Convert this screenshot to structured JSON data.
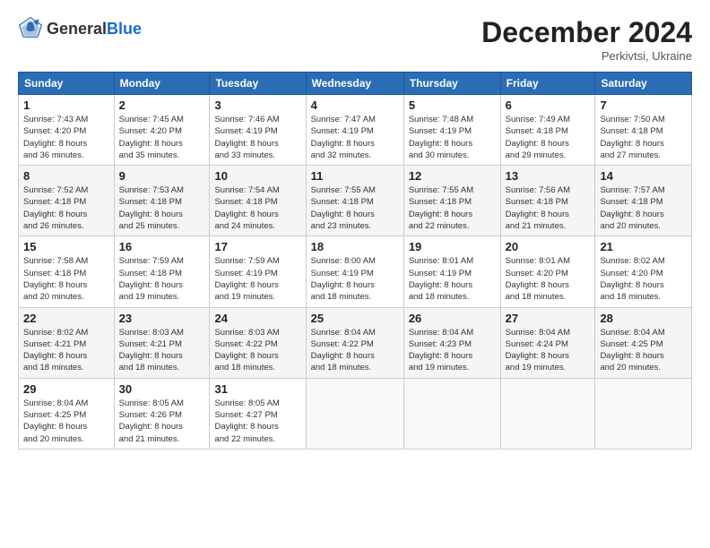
{
  "header": {
    "logo_general": "General",
    "logo_blue": "Blue",
    "title": "December 2024",
    "subtitle": "Perkivtsi, Ukraine"
  },
  "days_of_week": [
    "Sunday",
    "Monday",
    "Tuesday",
    "Wednesday",
    "Thursday",
    "Friday",
    "Saturday"
  ],
  "weeks": [
    [
      {
        "day": "1",
        "info": "Sunrise: 7:43 AM\nSunset: 4:20 PM\nDaylight: 8 hours\nand 36 minutes."
      },
      {
        "day": "2",
        "info": "Sunrise: 7:45 AM\nSunset: 4:20 PM\nDaylight: 8 hours\nand 35 minutes."
      },
      {
        "day": "3",
        "info": "Sunrise: 7:46 AM\nSunset: 4:19 PM\nDaylight: 8 hours\nand 33 minutes."
      },
      {
        "day": "4",
        "info": "Sunrise: 7:47 AM\nSunset: 4:19 PM\nDaylight: 8 hours\nand 32 minutes."
      },
      {
        "day": "5",
        "info": "Sunrise: 7:48 AM\nSunset: 4:19 PM\nDaylight: 8 hours\nand 30 minutes."
      },
      {
        "day": "6",
        "info": "Sunrise: 7:49 AM\nSunset: 4:18 PM\nDaylight: 8 hours\nand 29 minutes."
      },
      {
        "day": "7",
        "info": "Sunrise: 7:50 AM\nSunset: 4:18 PM\nDaylight: 8 hours\nand 27 minutes."
      }
    ],
    [
      {
        "day": "8",
        "info": "Sunrise: 7:52 AM\nSunset: 4:18 PM\nDaylight: 8 hours\nand 26 minutes."
      },
      {
        "day": "9",
        "info": "Sunrise: 7:53 AM\nSunset: 4:18 PM\nDaylight: 8 hours\nand 25 minutes."
      },
      {
        "day": "10",
        "info": "Sunrise: 7:54 AM\nSunset: 4:18 PM\nDaylight: 8 hours\nand 24 minutes."
      },
      {
        "day": "11",
        "info": "Sunrise: 7:55 AM\nSunset: 4:18 PM\nDaylight: 8 hours\nand 23 minutes."
      },
      {
        "day": "12",
        "info": "Sunrise: 7:55 AM\nSunset: 4:18 PM\nDaylight: 8 hours\nand 22 minutes."
      },
      {
        "day": "13",
        "info": "Sunrise: 7:56 AM\nSunset: 4:18 PM\nDaylight: 8 hours\nand 21 minutes."
      },
      {
        "day": "14",
        "info": "Sunrise: 7:57 AM\nSunset: 4:18 PM\nDaylight: 8 hours\nand 20 minutes."
      }
    ],
    [
      {
        "day": "15",
        "info": "Sunrise: 7:58 AM\nSunset: 4:18 PM\nDaylight: 8 hours\nand 20 minutes."
      },
      {
        "day": "16",
        "info": "Sunrise: 7:59 AM\nSunset: 4:18 PM\nDaylight: 8 hours\nand 19 minutes."
      },
      {
        "day": "17",
        "info": "Sunrise: 7:59 AM\nSunset: 4:19 PM\nDaylight: 8 hours\nand 19 minutes."
      },
      {
        "day": "18",
        "info": "Sunrise: 8:00 AM\nSunset: 4:19 PM\nDaylight: 8 hours\nand 18 minutes."
      },
      {
        "day": "19",
        "info": "Sunrise: 8:01 AM\nSunset: 4:19 PM\nDaylight: 8 hours\nand 18 minutes."
      },
      {
        "day": "20",
        "info": "Sunrise: 8:01 AM\nSunset: 4:20 PM\nDaylight: 8 hours\nand 18 minutes."
      },
      {
        "day": "21",
        "info": "Sunrise: 8:02 AM\nSunset: 4:20 PM\nDaylight: 8 hours\nand 18 minutes."
      }
    ],
    [
      {
        "day": "22",
        "info": "Sunrise: 8:02 AM\nSunset: 4:21 PM\nDaylight: 8 hours\nand 18 minutes."
      },
      {
        "day": "23",
        "info": "Sunrise: 8:03 AM\nSunset: 4:21 PM\nDaylight: 8 hours\nand 18 minutes."
      },
      {
        "day": "24",
        "info": "Sunrise: 8:03 AM\nSunset: 4:22 PM\nDaylight: 8 hours\nand 18 minutes."
      },
      {
        "day": "25",
        "info": "Sunrise: 8:04 AM\nSunset: 4:22 PM\nDaylight: 8 hours\nand 18 minutes."
      },
      {
        "day": "26",
        "info": "Sunrise: 8:04 AM\nSunset: 4:23 PM\nDaylight: 8 hours\nand 19 minutes."
      },
      {
        "day": "27",
        "info": "Sunrise: 8:04 AM\nSunset: 4:24 PM\nDaylight: 8 hours\nand 19 minutes."
      },
      {
        "day": "28",
        "info": "Sunrise: 8:04 AM\nSunset: 4:25 PM\nDaylight: 8 hours\nand 20 minutes."
      }
    ],
    [
      {
        "day": "29",
        "info": "Sunrise: 8:04 AM\nSunset: 4:25 PM\nDaylight: 8 hours\nand 20 minutes."
      },
      {
        "day": "30",
        "info": "Sunrise: 8:05 AM\nSunset: 4:26 PM\nDaylight: 8 hours\nand 21 minutes."
      },
      {
        "day": "31",
        "info": "Sunrise: 8:05 AM\nSunset: 4:27 PM\nDaylight: 8 hours\nand 22 minutes."
      },
      {
        "day": "",
        "info": ""
      },
      {
        "day": "",
        "info": ""
      },
      {
        "day": "",
        "info": ""
      },
      {
        "day": "",
        "info": ""
      }
    ]
  ]
}
